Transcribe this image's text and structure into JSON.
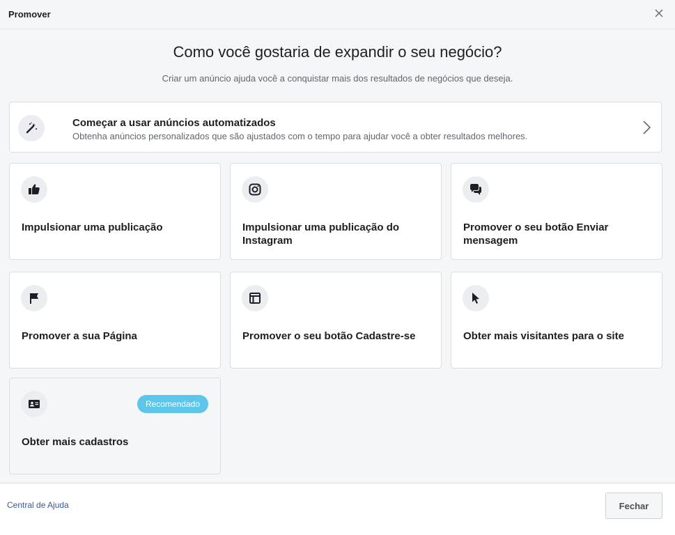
{
  "dialog": {
    "title": "Promover",
    "close_icon": "close-icon"
  },
  "main": {
    "heading": "Como você gostaria de expandir o seu negócio?",
    "subheading": "Criar um anúncio ajuda você a conquistar mais dos resultados de negócios que deseja."
  },
  "automated": {
    "title": "Começar a usar anúncios automatizados",
    "description": "Obtenha anúncios personalizados que são ajustados com o tempo para ajudar você a obter resultados melhores.",
    "icon": "magic-wand-icon"
  },
  "options": [
    {
      "label": "Impulsionar uma publicação",
      "icon": "thumbs-up-icon"
    },
    {
      "label": "Impulsionar uma publicação do Instagram",
      "icon": "instagram-icon"
    },
    {
      "label": "Promover o seu botão Enviar mensagem",
      "icon": "chat-bubbles-icon"
    },
    {
      "label": "Promover a sua Página",
      "icon": "flag-icon"
    },
    {
      "label": "Promover o seu botão Cadastre-se",
      "icon": "form-icon"
    },
    {
      "label": "Obter mais visitantes para o site",
      "icon": "cursor-icon"
    },
    {
      "label": "Obter mais cadastros",
      "icon": "contact-card-icon",
      "badge": "Recomendado"
    }
  ],
  "footer": {
    "help_link": "Central de Ajuda",
    "close_button": "Fechar"
  },
  "colors": {
    "badge": "#5bc6ea",
    "link": "#385898",
    "background": "#f5f6f7"
  }
}
